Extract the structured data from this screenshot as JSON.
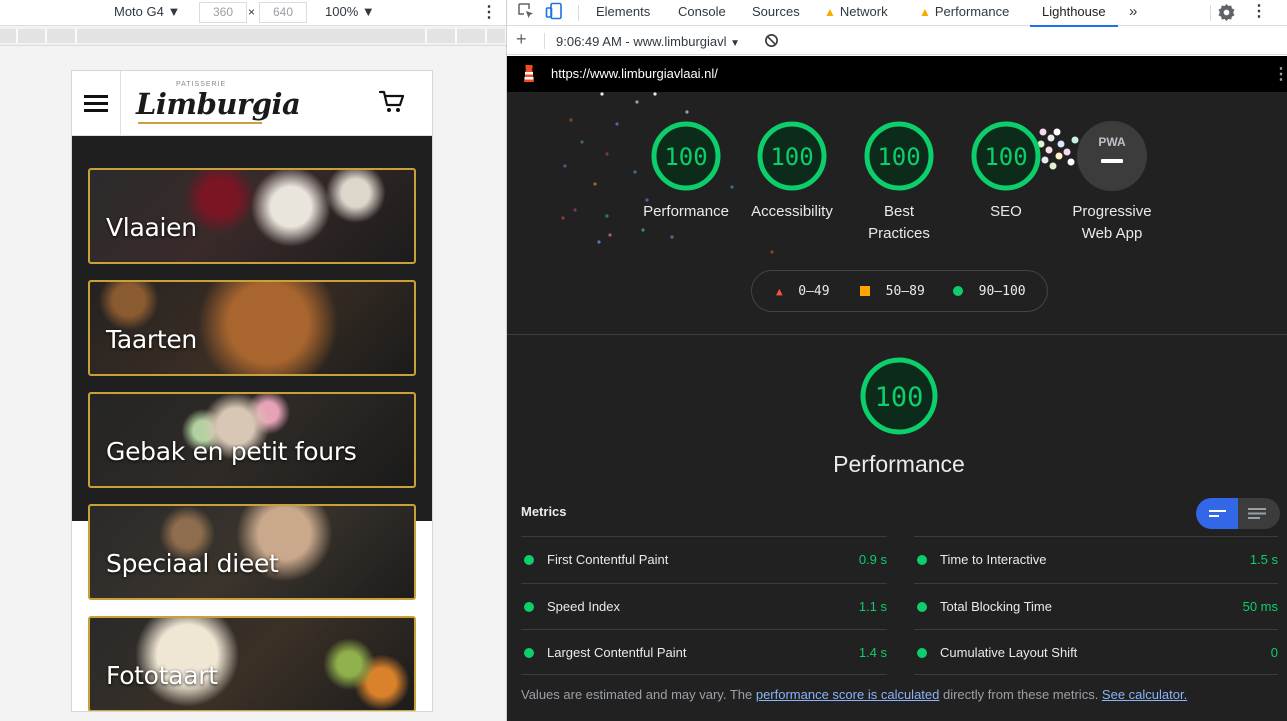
{
  "device_toolbar": {
    "device": "Moto G4",
    "width": "360",
    "times": "×",
    "height": "640",
    "zoom": "100%"
  },
  "site": {
    "logo_small": "PATISSERIE",
    "logo_main": "Limburgia",
    "categories": [
      {
        "label": "Vlaaien"
      },
      {
        "label": "Taarten"
      },
      {
        "label": "Gebak en petit fours"
      },
      {
        "label": "Speciaal dieet"
      },
      {
        "label": "Fototaart"
      }
    ]
  },
  "devtools": {
    "tabs": [
      {
        "label": "Elements"
      },
      {
        "label": "Console"
      },
      {
        "label": "Sources"
      },
      {
        "label": "Network"
      },
      {
        "label": "Performance"
      },
      {
        "label": "Lighthouse"
      }
    ],
    "active_tab": "Lighthouse",
    "report_select": "9:06:49 AM - www.limburgiavl",
    "report_url": "https://www.limburgiavlaai.nl/"
  },
  "lighthouse": {
    "gauges": [
      {
        "score": "100",
        "label_line1": "Performance",
        "label_line2": ""
      },
      {
        "score": "100",
        "label_line1": "Accessibility",
        "label_line2": ""
      },
      {
        "score": "100",
        "label_line1": "Best",
        "label_line2": "Practices"
      },
      {
        "score": "100",
        "label_line1": "SEO",
        "label_line2": ""
      }
    ],
    "pwa": {
      "badge": "PWA",
      "label_line1": "Progressive",
      "label_line2": "Web App"
    },
    "legend": {
      "low": "0–49",
      "mid": "50–89",
      "high": "90–100"
    },
    "performance": {
      "score": "100",
      "title": "Performance"
    },
    "metrics_title": "Metrics",
    "metrics": [
      {
        "name": "First Contentful Paint",
        "value": "0.9 s"
      },
      {
        "name": "Time to Interactive",
        "value": "1.5 s"
      },
      {
        "name": "Speed Index",
        "value": "1.1 s"
      },
      {
        "name": "Total Blocking Time",
        "value": "50 ms"
      },
      {
        "name": "Largest Contentful Paint",
        "value": "1.4 s"
      },
      {
        "name": "Cumulative Layout Shift",
        "value": "0"
      }
    ],
    "footnote": {
      "part1": "Values are estimated and may vary. The ",
      "link1": "performance score is calculated",
      "part2": " directly from these metrics. ",
      "link2": "See calculator."
    },
    "colors": {
      "pass": "#0cce6b",
      "average": "#ffa400",
      "fail": "#ff4e42"
    }
  }
}
